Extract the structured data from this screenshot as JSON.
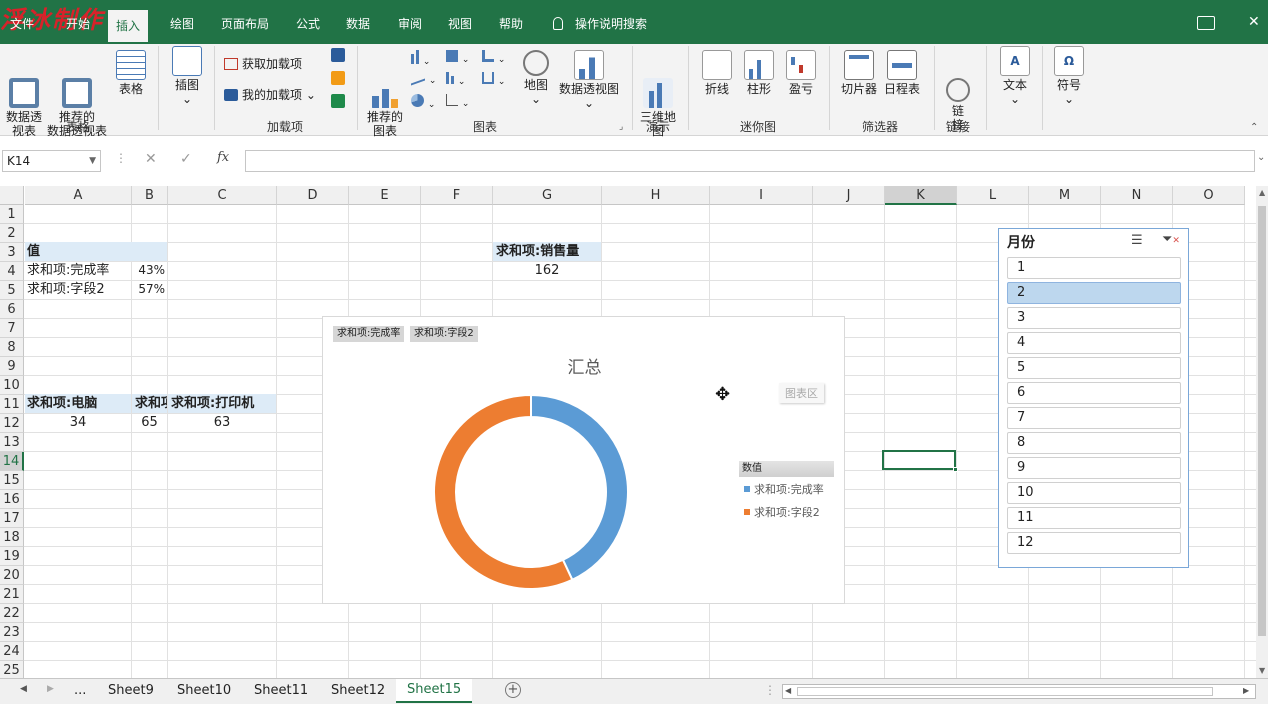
{
  "watermark": "浮冰制作",
  "ribbon_tabs": [
    "文件",
    "开始",
    "插入",
    "绘图",
    "页面布局",
    "公式",
    "数据",
    "审阅",
    "视图",
    "帮助"
  ],
  "tell_me": "操作说明搜索",
  "ribbon": {
    "pivot_table": "数据透\n视表",
    "recommended_pivot": "推荐的\n数据透视表",
    "table": "表格",
    "group_tables": "表格",
    "illustrations": "插图",
    "get_addins": "获取加载项",
    "my_addins": "我的加载项",
    "group_addins": "加载项",
    "recommended_charts": "推荐的\n图表",
    "map": "地图",
    "pivot_chart": "数据透视图",
    "group_charts": "图表",
    "map3d": "三维地\n图",
    "group_tours": "演示",
    "line": "折线",
    "column": "柱形",
    "winloss": "盈亏",
    "group_sparklines": "迷你图",
    "slicer": "切片器",
    "timeline": "日程表",
    "group_filters": "筛选器",
    "link": "链\n接",
    "group_links": "链接",
    "text": "文本",
    "symbol": "符号"
  },
  "namebox": "K14",
  "formula_value": "",
  "columns": [
    "A",
    "B",
    "C",
    "D",
    "E",
    "F",
    "G",
    "H",
    "I",
    "J",
    "K",
    "L",
    "M",
    "N",
    "O"
  ],
  "rows": [
    "1",
    "2",
    "3",
    "4",
    "5",
    "6",
    "7",
    "8",
    "9",
    "10",
    "11",
    "12",
    "13",
    "14",
    "15",
    "16",
    "17",
    "18",
    "19",
    "20",
    "21",
    "22",
    "23",
    "24",
    "25"
  ],
  "cells": {
    "a3": "值",
    "a4": "求和项:完成率",
    "b4": "43%",
    "a5": "求和项:字段2",
    "b5": "57%",
    "g3": "求和项:销售量",
    "g4": "162",
    "a11": "求和项:电脑",
    "b11": "求和项:打印机",
    "c11": "求和项:打印机",
    "a12": "34",
    "b12": "65",
    "c12": "63"
  },
  "chart": {
    "field_buttons": [
      "求和项:完成率",
      "求和项:字段2"
    ],
    "plot_area_tooltip": "图表区",
    "legend_title": "数值",
    "colors": [
      "#5b9bd5",
      "#ed7d31"
    ]
  },
  "chart_data": {
    "type": "pie",
    "title": "汇总",
    "donut": true,
    "categories": [
      "求和项:完成率",
      "求和项:字段2"
    ],
    "values": [
      0.43,
      0.57
    ]
  },
  "slicer": {
    "title": "月份",
    "items": [
      "1",
      "2",
      "3",
      "4",
      "5",
      "6",
      "7",
      "8",
      "9",
      "10",
      "11",
      "12"
    ],
    "selected": "2"
  },
  "sheets": [
    "Sheet9",
    "Sheet10",
    "Sheet11",
    "Sheet12",
    "Sheet15"
  ],
  "active_sheet": "Sheet15",
  "sheet_ellipsis": "..."
}
